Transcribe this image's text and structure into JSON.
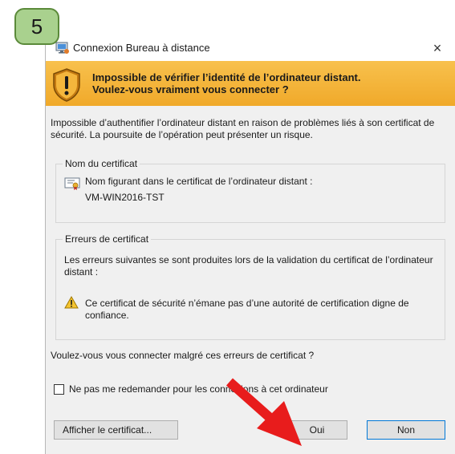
{
  "step": {
    "number": "5"
  },
  "window": {
    "title": "Connexion Bureau à distance",
    "close_label": "×"
  },
  "banner": {
    "line1": "Impossible de vérifier l’identité de l’ordinateur distant.",
    "line2": "Voulez-vous vraiment vous connecter ?"
  },
  "intro": {
    "text": "Impossible d’authentifier l’ordinateur distant en raison de problèmes liés à son certificat de sécurité. La poursuite de l’opération peut présenter un risque."
  },
  "certificate_group": {
    "legend": "Nom du certificat",
    "label": "Nom figurant dans le certificat de l’ordinateur distant :",
    "value": "VM-WIN2016-TST"
  },
  "errors_group": {
    "legend": "Erreurs de certificat",
    "description": "Les erreurs suivantes se sont produites lors de la validation du certificat de l’ordinateur distant :",
    "error_text": "Ce certificat de sécurité n’émane pas d’une autorité de certification digne de confiance."
  },
  "question": "Voulez-vous vous connecter malgré ces erreurs de certificat ?",
  "checkbox": {
    "label": "Ne pas me redemander pour les connexions à cet ordinateur",
    "checked": false
  },
  "buttons": {
    "show_certificate": "Afficher le certificat...",
    "yes": "Oui",
    "no": "Non"
  },
  "icons": {
    "title": "remote-desktop-icon",
    "banner": "shield-warning-icon",
    "certificate": "certificate-icon",
    "error": "warning-triangle-icon",
    "annotation": "red-arrow-icon"
  },
  "colors": {
    "banner": "#f6b93b",
    "step_badge": "#a9d18e",
    "arrow": "#e81c1c",
    "focus_border": "#0078d7"
  }
}
